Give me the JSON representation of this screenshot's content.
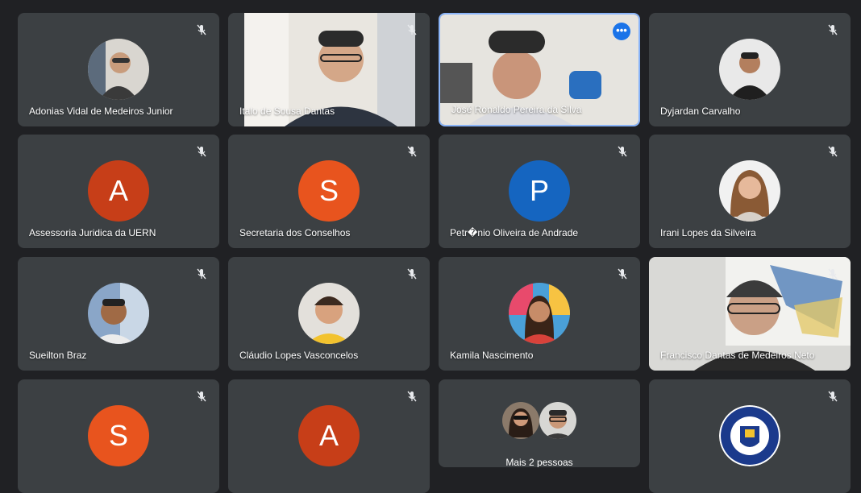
{
  "participants": [
    {
      "name": "Adonias Vidal de Medeiros Junior"
    },
    {
      "name": "Italo de Sousa Dantas"
    },
    {
      "name": "José Ronaldo Pereira da Silva"
    },
    {
      "name": "Dyjardan Carvalho"
    },
    {
      "name": "Assessoria Juridica da UERN",
      "initial": "A"
    },
    {
      "name": "Secretaria dos Conselhos",
      "initial": "S"
    },
    {
      "name": "Petr�nio Oliveira de Andrade",
      "initial": "P"
    },
    {
      "name": "Irani Lopes da Silveira"
    },
    {
      "name": "Sueilton Braz"
    },
    {
      "name": "Cláudio Lopes Vasconcelos"
    },
    {
      "name": "Kamila Nascimento"
    },
    {
      "name": "Francisco Dantas de Medeiros Neto"
    },
    {
      "initial": "S"
    },
    {
      "initial": "A"
    },
    {
      "more_label": "Mais 2 pessoas"
    },
    {}
  ],
  "more_options_glyph": "•••",
  "colors": {
    "background": "#202124",
    "tile": "#3c4043",
    "active_border": "#8ab4f8",
    "orange_avatar": "#e8541e",
    "blue_avatar": "#1565c0"
  }
}
